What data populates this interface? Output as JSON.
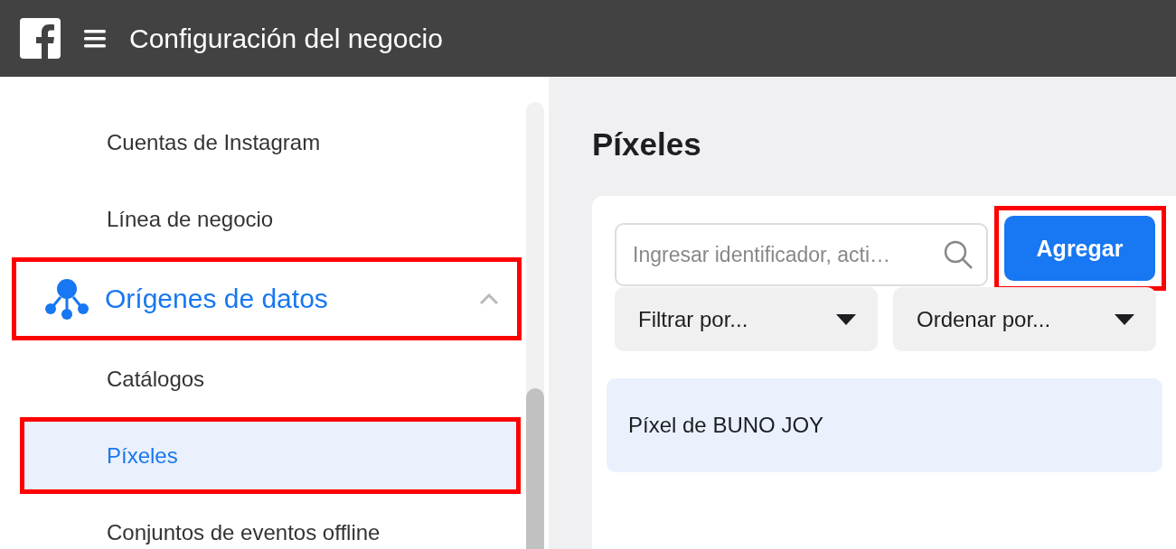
{
  "header": {
    "title": "Configuración del negocio"
  },
  "sidebar": {
    "items": [
      {
        "kind": "link",
        "label": "Cuentas de Instagram",
        "selected": false,
        "highlighted": false
      },
      {
        "kind": "link",
        "label": "Línea de negocio",
        "selected": false,
        "highlighted": false
      },
      {
        "kind": "section",
        "label": "Orígenes de datos",
        "selected": false,
        "expanded": true,
        "highlighted": true
      },
      {
        "kind": "link",
        "label": "Catálogos",
        "selected": false,
        "highlighted": false
      },
      {
        "kind": "link",
        "label": "Píxeles",
        "selected": true,
        "highlighted": true
      },
      {
        "kind": "link",
        "label": "Conjuntos de eventos offline",
        "selected": false,
        "highlighted": false
      }
    ]
  },
  "main": {
    "title": "Píxeles",
    "search": {
      "placeholder": "Ingresar identificador, acti…"
    },
    "add_button": {
      "label": "Agregar",
      "highlighted": true
    },
    "filters": [
      {
        "label": "Filtrar por..."
      },
      {
        "label": "Ordenar por..."
      }
    ],
    "pixels": [
      {
        "name": "Píxel de BUNO JOY",
        "selected": true
      }
    ]
  }
}
